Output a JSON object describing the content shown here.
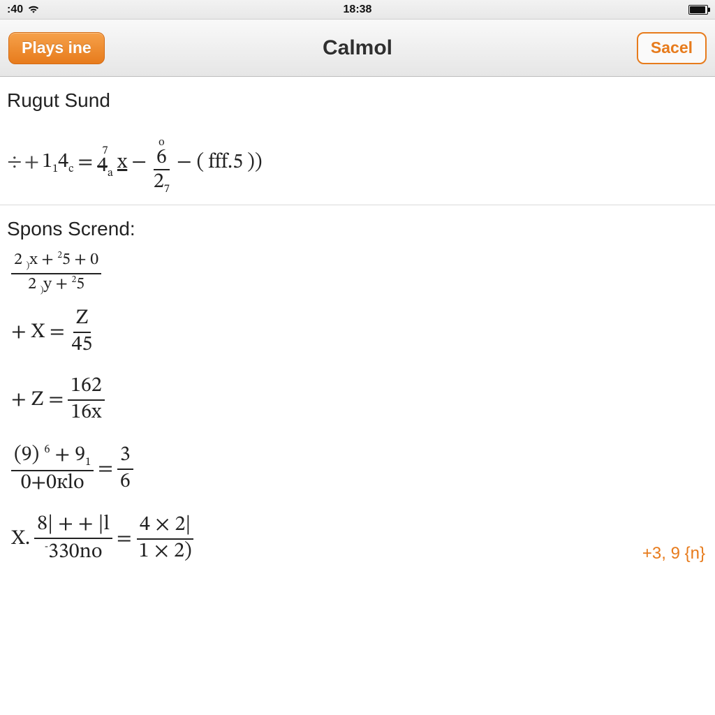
{
  "status": {
    "left_text": ":40",
    "time": "18:38"
  },
  "nav": {
    "left_button": "Plays ine",
    "title": "Calmol",
    "right_button": "Sacel"
  },
  "section1": {
    "title": "Rugut Sund",
    "eq": {
      "lead": "÷ +",
      "a": "1",
      "a_sub": "1",
      "b": "4",
      "b_sub": "c",
      "eq": " = ",
      "c_top": "7",
      "c_cross": "4",
      "c_sub": "a",
      "x": "x",
      "minus": " − ",
      "frac_top_over": "o",
      "frac_top": "6",
      "frac_bot": "2",
      "frac_bot_sub": "7",
      "minus2": " − (",
      "paren": "fff.5",
      "close": "))"
    }
  },
  "section2": {
    "title": "Spons Scrend:",
    "eq1": {
      "l_top_a": "2",
      "l_top_b": ")",
      "l_top_c": "x + ",
      "l_top_sup": "2",
      "l_top_d": "5 + 0",
      "l_bot_a": "2",
      "l_bot_b": ")",
      "l_bot_c": "y + ",
      "l_bot_sup": "2",
      "l_bot_d": "5"
    },
    "eq2": {
      "lead": "+ X = ",
      "top": "Z",
      "bot": "45"
    },
    "eq3": {
      "lead": "+ Z = ",
      "top": "162",
      "bot": "16x"
    },
    "eq4": {
      "l_top": "(9) ",
      "l_top_sup": "6",
      "l_top2": " + 9",
      "l_top_sub": "1",
      "l_bot": "0+0кlo",
      "eq": " = ",
      "r_top": "3",
      "r_bot": "6"
    },
    "eq5": {
      "lead": "X.",
      "l_top": "8| + + |l",
      "l_bot": "330no",
      "l_bot_sup": "-",
      "eq": " = ",
      "r_top": "4 × 2|",
      "r_bot": "1 × 2)"
    },
    "side": "+3, 9 {n}"
  }
}
